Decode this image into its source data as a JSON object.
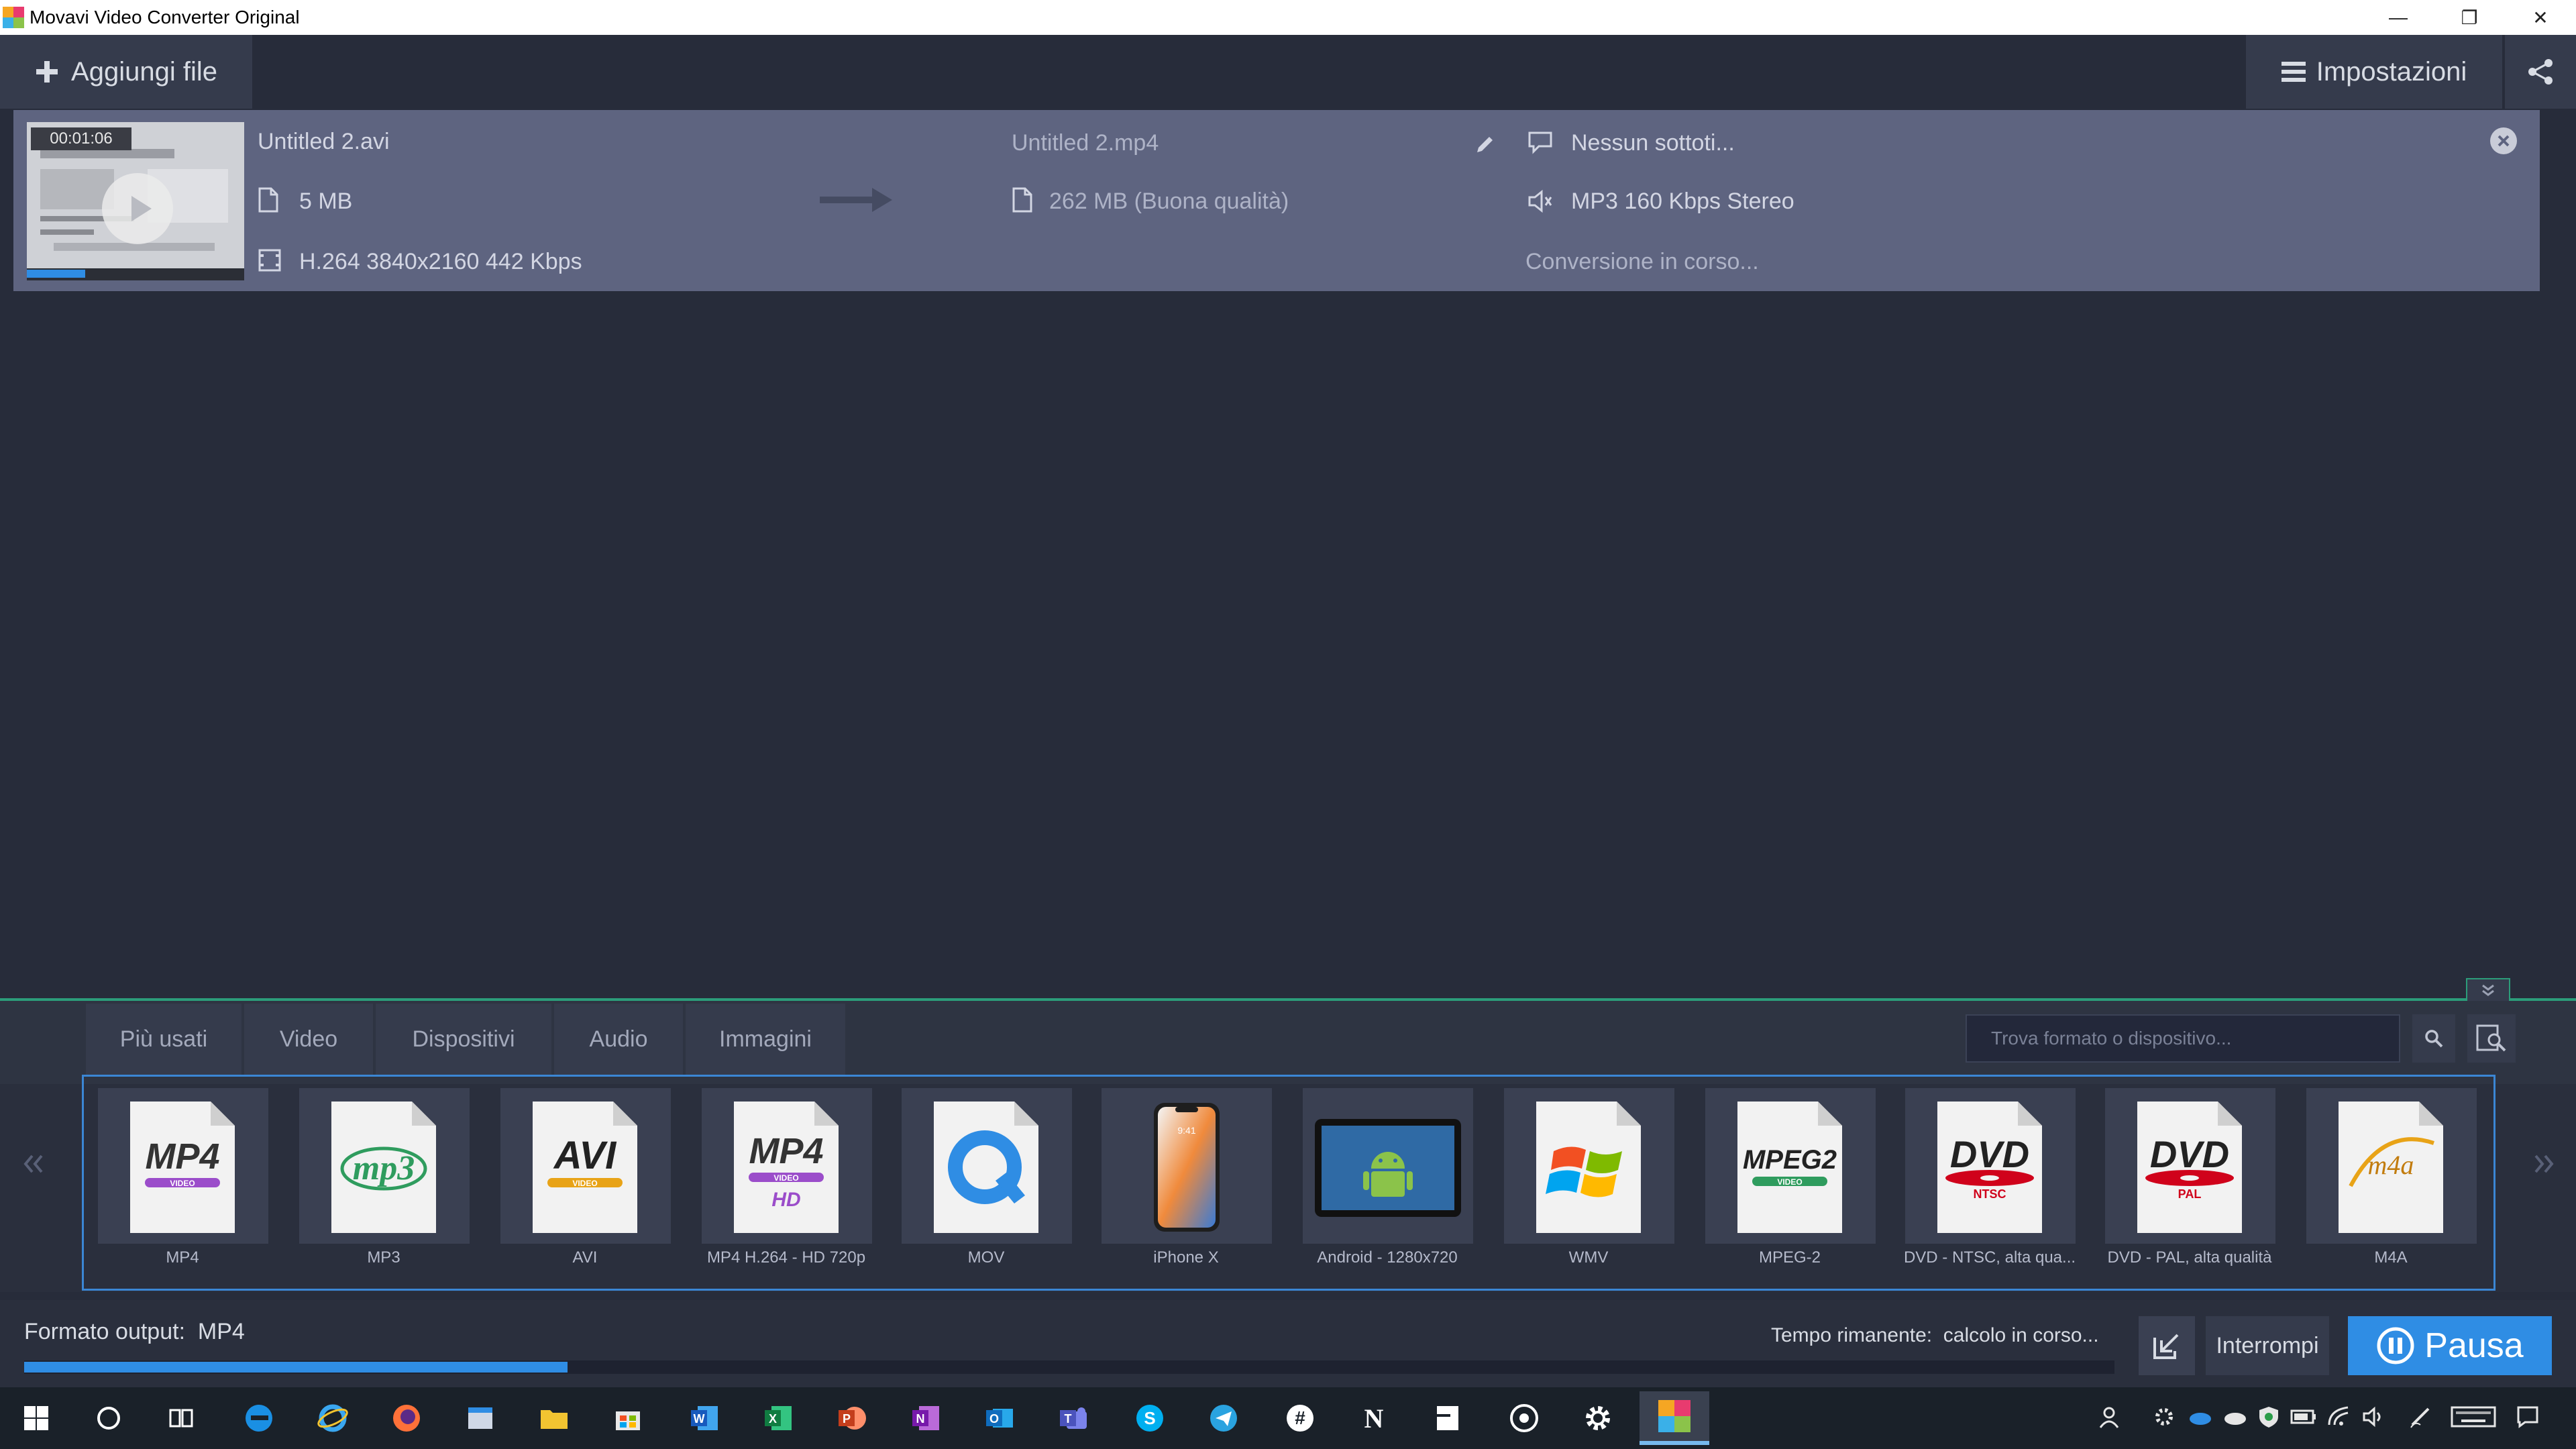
{
  "window": {
    "title": "Movavi Video Converter Original",
    "minimize_glyph": "—",
    "restore_glyph": "❐",
    "close_glyph": "✕"
  },
  "toolbar": {
    "add_file_label": "Aggiungi file",
    "settings_label": "Impostazioni"
  },
  "file": {
    "thumbnail_time": "00:01:06",
    "input_name": "Untitled 2.avi",
    "input_size": "5 MB",
    "input_codec": "H.264 3840x2160 442 Kbps",
    "output_name": "Untitled 2.mp4",
    "output_size": "262 MB (Buona qualità)",
    "subtitles": "Nessun sottoti...",
    "audio": "MP3 160 Kbps Stereo",
    "status": "Conversione in corso...",
    "thumbnail_progress": 0.27
  },
  "tabs": [
    {
      "label": "Più usati"
    },
    {
      "label": "Video"
    },
    {
      "label": "Dispositivi"
    },
    {
      "label": "Audio"
    },
    {
      "label": "Immagini"
    }
  ],
  "search": {
    "placeholder": "Trova formato o dispositivo..."
  },
  "formats": [
    {
      "label": "MP4",
      "icon": "mp4-icon"
    },
    {
      "label": "MP3",
      "icon": "mp3-icon"
    },
    {
      "label": "AVI",
      "icon": "avi-icon"
    },
    {
      "label": "MP4 H.264 - HD 720p",
      "icon": "mp4-hd-icon"
    },
    {
      "label": "MOV",
      "icon": "quicktime-icon"
    },
    {
      "label": "iPhone X",
      "icon": "iphone-icon"
    },
    {
      "label": "Android - 1280x720",
      "icon": "android-tablet-icon"
    },
    {
      "label": "WMV",
      "icon": "windows-media-icon"
    },
    {
      "label": "MPEG-2",
      "icon": "mpeg2-icon"
    },
    {
      "label": "DVD - NTSC, alta qua...",
      "icon": "dvd-ntsc-icon"
    },
    {
      "label": "DVD - PAL, alta qualità",
      "icon": "dvd-pal-icon"
    },
    {
      "label": "M4A",
      "icon": "m4a-icon"
    }
  ],
  "format_icon_text": {
    "mp4": "MP4",
    "video": "VIDEO",
    "mp3": "mp3",
    "avi": "AVI",
    "hd": "HD",
    "mpeg2": "MPEG2",
    "dvd": "DVD",
    "ntsc": "NTSC",
    "pal": "PAL",
    "m4a": "m4a",
    "phone_time": "9:41"
  },
  "status_bar": {
    "output_label": "Formato output:",
    "output_value": "MP4",
    "remaining_label": "Tempo rimanente:",
    "remaining_value": "calcolo in corso...",
    "overall_progress": 0.26,
    "stop_label": "Interrompi",
    "pause_label": "Pausa"
  },
  "colors": {
    "accent": "#2f8de4",
    "divider": "#2c9d7a",
    "file_row": "#5e6480",
    "background": "#272c3a"
  }
}
